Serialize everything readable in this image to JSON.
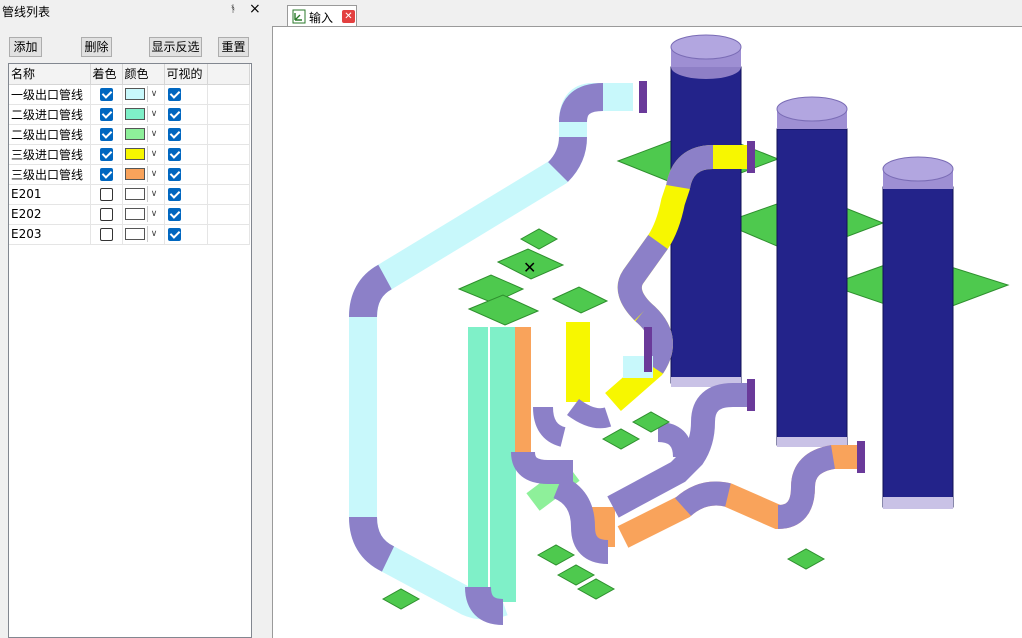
{
  "panel": {
    "title": "管线列表",
    "pin_glyph": "ᚬ",
    "close_glyph": "×"
  },
  "toolbar": {
    "add_label": "添加",
    "delete_label": "删除",
    "invert_label": "显示反选",
    "reset_label": "重置"
  },
  "table": {
    "headers": [
      "名称",
      "着色",
      "颜色",
      "可视的"
    ],
    "rows": [
      {
        "name": "一级出口管线",
        "colored": true,
        "color": "#c8f8fb",
        "visible": true
      },
      {
        "name": "二级进口管线",
        "colored": true,
        "color": "#7ff0c8",
        "visible": true
      },
      {
        "name": "二级出口管线",
        "colored": true,
        "color": "#8ef09a",
        "visible": true
      },
      {
        "name": "三级进口管线",
        "colored": true,
        "color": "#f7f700",
        "visible": true
      },
      {
        "name": "三级出口管线",
        "colored": true,
        "color": "#f9a35b",
        "visible": true
      },
      {
        "name": "E201",
        "colored": false,
        "color": "#ffffff",
        "visible": true
      },
      {
        "name": "E202",
        "colored": false,
        "color": "#ffffff",
        "visible": true
      },
      {
        "name": "E203",
        "colored": false,
        "color": "#ffffff",
        "visible": true
      }
    ]
  },
  "document": {
    "tab_label": "输入"
  },
  "scene_colors": {
    "vessel": "#23238a",
    "vessel_cap": "#9e8fd3",
    "elbow": "#8c80c8",
    "platform": "#4ec94e",
    "flange": "#6a3a9a"
  }
}
